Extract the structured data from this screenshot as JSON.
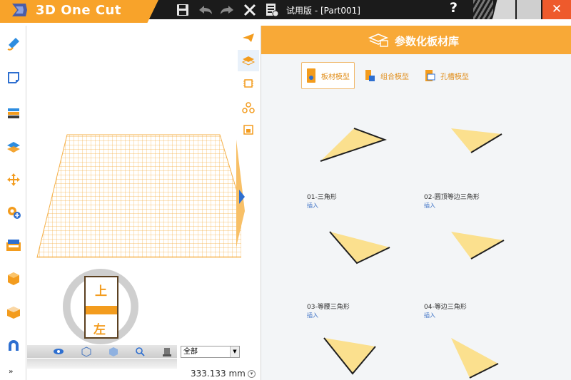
{
  "app": {
    "name": "3D One Cut",
    "window_title": "试用版 - [Part001]"
  },
  "titlebar": {
    "icons": [
      "save-icon",
      "undo-icon",
      "redo-icon",
      "close-doc-icon",
      "clipboard-icon"
    ],
    "help_label": "?",
    "close_label": "✕"
  },
  "left_tools": [
    "pen-icon",
    "sketch-icon",
    "layers-icon",
    "stack-icon",
    "move-icon",
    "gear-add-icon",
    "assembly-icon",
    "cube-icon",
    "box-icon",
    "magnet-icon"
  ],
  "left_tools_more": "»",
  "viewport": {
    "side_icons": [
      "send-icon",
      "library-icon",
      "chip-icon",
      "nodes-icon",
      "image-icon"
    ],
    "view_cube": {
      "top_label": "上",
      "front_label": "左"
    },
    "display_filter": "全部",
    "measurement": "333.133 mm",
    "colors": {
      "grid": "#f5b14a",
      "accent": "#f8a32a"
    }
  },
  "library": {
    "title": "参数化板材库",
    "tabs": [
      {
        "label": "板材模型",
        "active": true
      },
      {
        "label": "组合模型",
        "active": false
      },
      {
        "label": "孔槽模型",
        "active": false
      }
    ],
    "items": [
      {
        "name": "01-三角形",
        "action": "插入"
      },
      {
        "name": "02-圆顶等边三角形",
        "action": "插入"
      },
      {
        "name": "03-等腰三角形",
        "action": "插入"
      },
      {
        "name": "04-等边三角形",
        "action": "插入"
      }
    ],
    "colors": {
      "header": "#f8a937",
      "shape_fill": "#fbe08e",
      "shape_edge": "#1f1f1f",
      "link": "#3a6fc4"
    }
  }
}
